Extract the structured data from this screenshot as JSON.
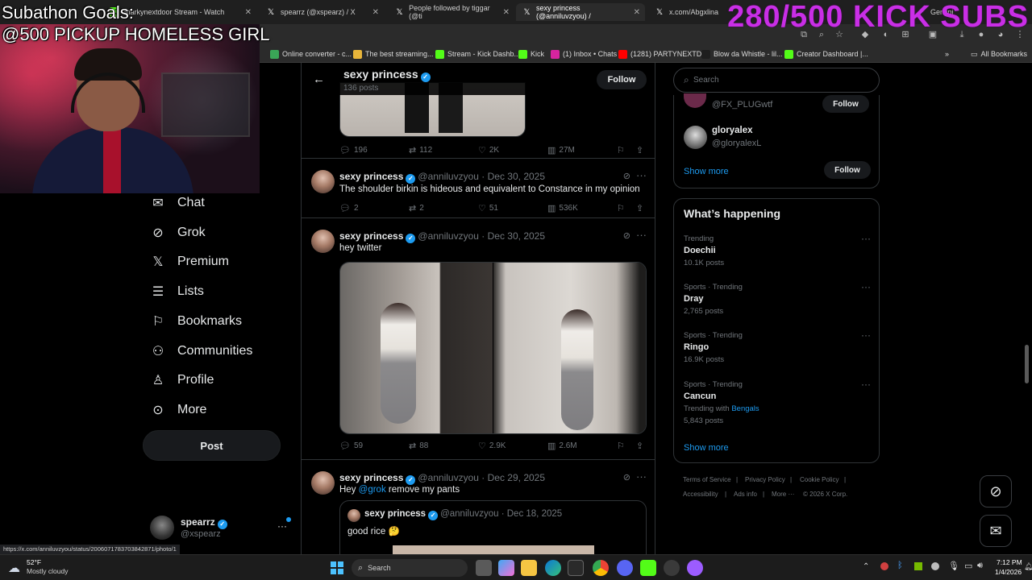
{
  "browser": {
    "tabs": [
      {
        "label": "markynextdoor Stream - Watch",
        "icon": "kick-icon",
        "active": false
      },
      {
        "label": "spearrz (@xspearz) / X",
        "icon": "x-logo-icon",
        "active": false
      },
      {
        "label": "People followed by tiggar (@ti",
        "icon": "x-logo-icon",
        "active": false
      },
      {
        "label": "sexy princess (@anniluvzyou) /",
        "icon": "x-logo-icon",
        "active": true
      },
      {
        "label": "x.com/Abgxlina",
        "icon": "x-logo-icon",
        "active": false
      },
      {
        "label": "Gemini",
        "icon": "gemini-icon",
        "active": false
      }
    ],
    "bookmarks": [
      {
        "label": "Online converter - c...",
        "color": "#3aa657"
      },
      {
        "label": "The best streaming...",
        "color": "#e8b53a"
      },
      {
        "label": "Stream - Kick Dashb...",
        "color": "#53fc18"
      },
      {
        "label": "Kick",
        "color": "#53fc18"
      },
      {
        "label": "(1) Inbox • Chats",
        "color": "#d6249f"
      },
      {
        "label": "(1281) PARTYNEXTD...",
        "color": "#ff0000"
      },
      {
        "label": "Blow da Whistle - lil...",
        "color": "#1e1e1e"
      },
      {
        "label": "Creator Dashboard |...",
        "color": "#53fc18"
      }
    ],
    "all_bookmarks": "All Bookmarks",
    "status_url": "https://x.com/anniluvzyou/status/2006071783703842871/photo/1"
  },
  "overlay": {
    "goal_line1": "Subathon Goals:",
    "goal_line2": "@500 PICKUP HOMELESS GIRL",
    "subs": "280/500 KICK SUBS"
  },
  "sidebar": {
    "items": [
      {
        "label": "Chat",
        "icon": "chat-icon"
      },
      {
        "label": "Grok",
        "icon": "grok-icon"
      },
      {
        "label": "Premium",
        "icon": "x-logo-icon"
      },
      {
        "label": "Lists",
        "icon": "lists-icon"
      },
      {
        "label": "Bookmarks",
        "icon": "bookmark-icon"
      },
      {
        "label": "Communities",
        "icon": "communities-icon"
      },
      {
        "label": "Profile",
        "icon": "profile-icon"
      },
      {
        "label": "More",
        "icon": "more-circle-icon"
      }
    ],
    "post_label": "Post",
    "account": {
      "name": "spearrz",
      "handle": "@xspearz"
    }
  },
  "profile_header": {
    "name": "sexy princess",
    "posts": "136 posts",
    "follow_label": "Follow"
  },
  "tweets": [
    {
      "stats": {
        "replies": "196",
        "reposts": "112",
        "likes": "2K",
        "views": "27M"
      }
    },
    {
      "name": "sexy princess",
      "handle": "@anniluvzyou",
      "date": "· Dec 30, 2025",
      "text": "The shoulder birkin is hideous and equivalent to Constance in my opinion",
      "stats": {
        "replies": "2",
        "reposts": "2",
        "likes": "51",
        "views": "536K"
      }
    },
    {
      "name": "sexy princess",
      "handle": "@anniluvzyou",
      "date": "· Dec 30, 2025",
      "text": "hey twitter",
      "stats": {
        "replies": "59",
        "reposts": "88",
        "likes": "2.9K",
        "views": "2.6M"
      }
    },
    {
      "name": "sexy princess",
      "handle": "@anniluvzyou",
      "date": "· Dec 29, 2025",
      "text_prefix": "Hey ",
      "text_mention": "@grok",
      "text_suffix": " remove my pants",
      "quote": {
        "name": "sexy princess",
        "handle": "@anniluvzyou",
        "date": "· Dec 18, 2025",
        "text": "good rice 🤔"
      }
    }
  ],
  "right": {
    "search_placeholder": "Search",
    "who_to_follow": [
      {
        "handle": "@FX_PLUGwtf",
        "follow_label": "Follow"
      },
      {
        "name": "gloryalex",
        "handle": "@gloryalexL",
        "follow_label": "Follow"
      }
    ],
    "show_more_1": "Show more",
    "happening_title": "What’s happening",
    "trends": [
      {
        "context": "Trending",
        "title": "Doechii",
        "count": "10.1K posts"
      },
      {
        "context": "Sports · Trending",
        "title": "Dray",
        "count": "2,765 posts"
      },
      {
        "context": "Sports · Trending",
        "title": "Ringo",
        "count": "16.9K posts"
      },
      {
        "context": "Sports · Trending",
        "title": "Cancun",
        "with_prefix": "Trending with",
        "with_link": "Bengals",
        "count": "5,843 posts"
      }
    ],
    "show_more_2": "Show more",
    "footer": [
      "Terms of Service",
      "Privacy Policy",
      "Cookie Policy",
      "Accessibility",
      "Ads info",
      "More ···",
      "© 2026 X Corp."
    ]
  },
  "taskbar": {
    "weather_temp": "52°F",
    "weather_desc": "Mostly cloudy",
    "search_label": "Search",
    "time": "7:12 PM",
    "date": "1/4/2026"
  },
  "colors": {
    "accent": "#1d9bf0",
    "overlay_subs": "#c92ee6",
    "background": "#000000"
  }
}
